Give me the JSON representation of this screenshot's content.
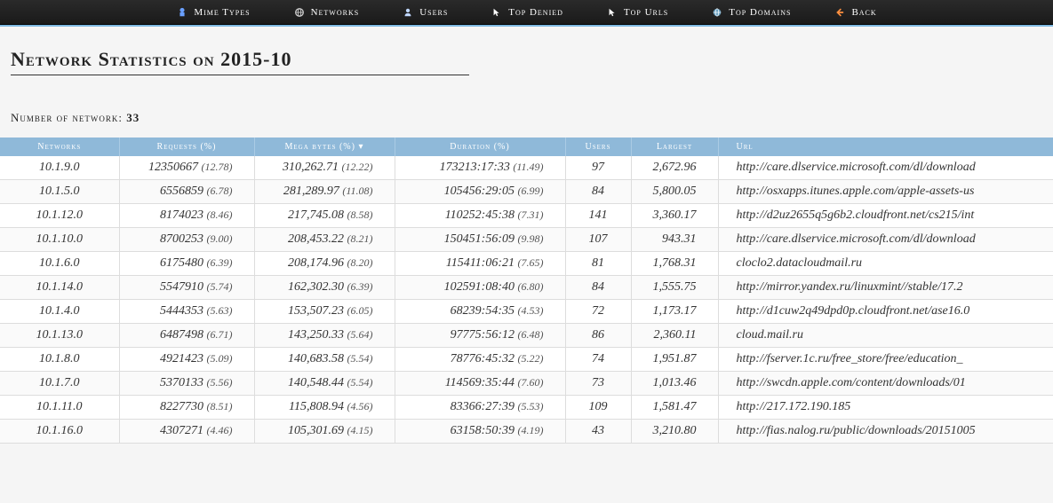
{
  "nav": {
    "items": [
      {
        "label": "Mime Types",
        "icon": "mime"
      },
      {
        "label": "Networks",
        "icon": "network"
      },
      {
        "label": "Users",
        "icon": "user"
      },
      {
        "label": "Top Denied",
        "icon": "cursor"
      },
      {
        "label": "Top Urls",
        "icon": "cursor"
      },
      {
        "label": "Top Domains",
        "icon": "domain"
      },
      {
        "label": "Back",
        "icon": "back"
      }
    ]
  },
  "page": {
    "title": "Network Statistics on 2015-10",
    "subtitle_label": "Number of network:",
    "subtitle_count": "33"
  },
  "table": {
    "headers": {
      "networks": "Networks",
      "requests": "Requests (%)",
      "mb": "Mega bytes (%) ▾",
      "duration": "Duration (%)",
      "users": "Users",
      "largest": "Largest",
      "url": "Url"
    },
    "rows": [
      {
        "net": "10.1.9.0",
        "req": "12350667",
        "req_pct": "(12.78)",
        "mb": "310,262.71",
        "mb_pct": "(12.22)",
        "dur": "173213:17:33",
        "dur_pct": "(11.49)",
        "users": "97",
        "largest": "2,672.96",
        "url": "http://care.dlservice.microsoft.com/dl/download"
      },
      {
        "net": "10.1.5.0",
        "req": "6556859",
        "req_pct": "(6.78)",
        "mb": "281,289.97",
        "mb_pct": "(11.08)",
        "dur": "105456:29:05",
        "dur_pct": "(6.99)",
        "users": "84",
        "largest": "5,800.05",
        "url": "http://osxapps.itunes.apple.com/apple-assets-us"
      },
      {
        "net": "10.1.12.0",
        "req": "8174023",
        "req_pct": "(8.46)",
        "mb": "217,745.08",
        "mb_pct": "(8.58)",
        "dur": "110252:45:38",
        "dur_pct": "(7.31)",
        "users": "141",
        "largest": "3,360.17",
        "url": "http://d2uz2655q5g6b2.cloudfront.net/cs215/int"
      },
      {
        "net": "10.1.10.0",
        "req": "8700253",
        "req_pct": "(9.00)",
        "mb": "208,453.22",
        "mb_pct": "(8.21)",
        "dur": "150451:56:09",
        "dur_pct": "(9.98)",
        "users": "107",
        "largest": "943.31",
        "url": "http://care.dlservice.microsoft.com/dl/download"
      },
      {
        "net": "10.1.6.0",
        "req": "6175480",
        "req_pct": "(6.39)",
        "mb": "208,174.96",
        "mb_pct": "(8.20)",
        "dur": "115411:06:21",
        "dur_pct": "(7.65)",
        "users": "81",
        "largest": "1,768.31",
        "url": "cloclo2.datacloudmail.ru"
      },
      {
        "net": "10.1.14.0",
        "req": "5547910",
        "req_pct": "(5.74)",
        "mb": "162,302.30",
        "mb_pct": "(6.39)",
        "dur": "102591:08:40",
        "dur_pct": "(6.80)",
        "users": "84",
        "largest": "1,555.75",
        "url": "http://mirror.yandex.ru/linuxmint//stable/17.2"
      },
      {
        "net": "10.1.4.0",
        "req": "5444353",
        "req_pct": "(5.63)",
        "mb": "153,507.23",
        "mb_pct": "(6.05)",
        "dur": "68239:54:35",
        "dur_pct": "(4.53)",
        "users": "72",
        "largest": "1,173.17",
        "url": "http://d1cuw2q49dpd0p.cloudfront.net/ase16.0"
      },
      {
        "net": "10.1.13.0",
        "req": "6487498",
        "req_pct": "(6.71)",
        "mb": "143,250.33",
        "mb_pct": "(5.64)",
        "dur": "97775:56:12",
        "dur_pct": "(6.48)",
        "users": "86",
        "largest": "2,360.11",
        "url": "cloud.mail.ru"
      },
      {
        "net": "10.1.8.0",
        "req": "4921423",
        "req_pct": "(5.09)",
        "mb": "140,683.58",
        "mb_pct": "(5.54)",
        "dur": "78776:45:32",
        "dur_pct": "(5.22)",
        "users": "74",
        "largest": "1,951.87",
        "url": "http://fserver.1c.ru/free_store/free/education_"
      },
      {
        "net": "10.1.7.0",
        "req": "5370133",
        "req_pct": "(5.56)",
        "mb": "140,548.44",
        "mb_pct": "(5.54)",
        "dur": "114569:35:44",
        "dur_pct": "(7.60)",
        "users": "73",
        "largest": "1,013.46",
        "url": "http://swcdn.apple.com/content/downloads/01"
      },
      {
        "net": "10.1.11.0",
        "req": "8227730",
        "req_pct": "(8.51)",
        "mb": "115,808.94",
        "mb_pct": "(4.56)",
        "dur": "83366:27:39",
        "dur_pct": "(5.53)",
        "users": "109",
        "largest": "1,581.47",
        "url": "http://217.172.190.185"
      },
      {
        "net": "10.1.16.0",
        "req": "4307271",
        "req_pct": "(4.46)",
        "mb": "105,301.69",
        "mb_pct": "(4.15)",
        "dur": "63158:50:39",
        "dur_pct": "(4.19)",
        "users": "43",
        "largest": "3,210.80",
        "url": "http://fias.nalog.ru/public/downloads/20151005"
      }
    ]
  },
  "icons": {
    "mime": "#6aa0ff",
    "network": "#d0d0d0",
    "user": "#c0d8ff",
    "cursor": "#ffffff",
    "domain": "#6aa0c0",
    "back": "#ff9040"
  }
}
